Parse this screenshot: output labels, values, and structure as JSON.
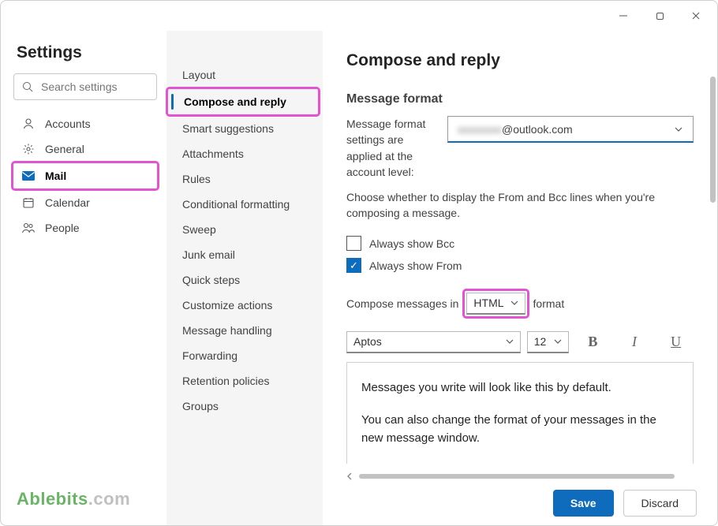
{
  "window": {
    "title": "Settings"
  },
  "search": {
    "placeholder": "Search settings"
  },
  "sidebar": {
    "title": "Settings",
    "items": [
      {
        "label": "Accounts",
        "icon": "person-icon"
      },
      {
        "label": "General",
        "icon": "gear-icon"
      },
      {
        "label": "Mail",
        "icon": "mail-icon",
        "selected": true
      },
      {
        "label": "Calendar",
        "icon": "calendar-icon"
      },
      {
        "label": "People",
        "icon": "people-icon"
      }
    ]
  },
  "subnav": {
    "items": [
      {
        "label": "Layout"
      },
      {
        "label": "Compose and reply",
        "selected": true
      },
      {
        "label": "Smart suggestions"
      },
      {
        "label": "Attachments"
      },
      {
        "label": "Rules"
      },
      {
        "label": "Conditional formatting"
      },
      {
        "label": "Sweep"
      },
      {
        "label": "Junk email"
      },
      {
        "label": "Quick steps"
      },
      {
        "label": "Customize actions"
      },
      {
        "label": "Message handling"
      },
      {
        "label": "Forwarding"
      },
      {
        "label": "Retention policies"
      },
      {
        "label": "Groups"
      }
    ]
  },
  "main": {
    "heading": "Compose and reply",
    "section_heading": "Message format",
    "account_label": "Message format settings are applied at the account level:",
    "account_value_masked": "",
    "account_value_suffix": "@outlook.com",
    "helptext": "Choose whether to display the From and Bcc lines when you're composing a message.",
    "checkbox_bcc_label": "Always show Bcc",
    "checkbox_bcc_checked": false,
    "checkbox_from_label": "Always show From",
    "checkbox_from_checked": true,
    "compose_prefix": "Compose messages in",
    "compose_select_value": "HTML",
    "compose_suffix": "format",
    "font_name": "Aptos",
    "font_size": "12",
    "preview_line1": "Messages you write will look like this by default.",
    "preview_line2": "You can also change the format of your messages in the new message window."
  },
  "footer": {
    "save": "Save",
    "discard": "Discard"
  },
  "brand": {
    "part1": "Ablebits",
    "part2": ".com"
  }
}
